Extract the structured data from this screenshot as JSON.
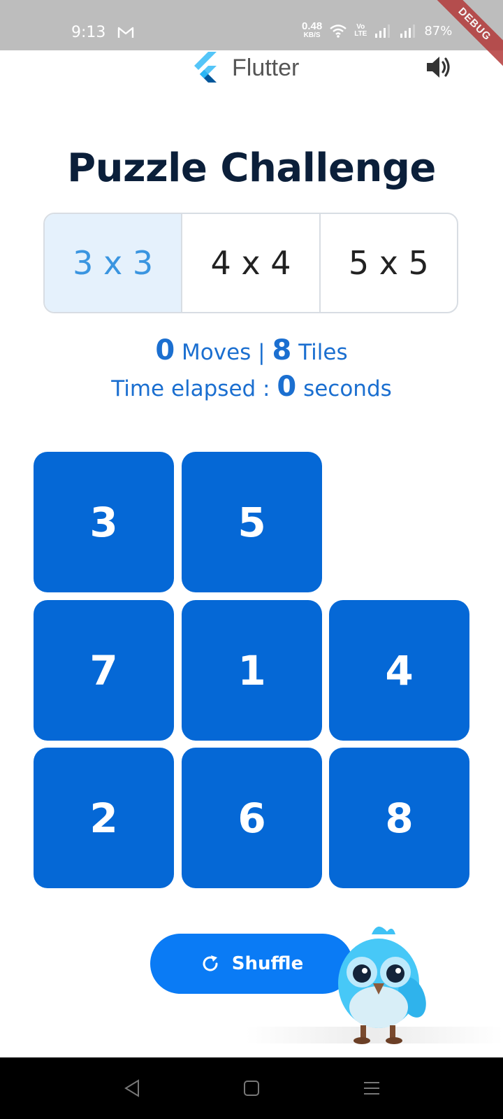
{
  "status_bar": {
    "time": "9:13",
    "mail_icon": "gmail-icon",
    "net_speed_value": "0.48",
    "net_speed_unit": "KB/S",
    "volte_top": "Vo",
    "volte_bottom": "LTE",
    "battery": "87%",
    "debug_label": "DEBUG"
  },
  "app_bar": {
    "app_name": "Flutter",
    "logo_icon": "flutter-logo",
    "sound_icon": "volume-icon"
  },
  "title": "Puzzle Challenge",
  "size_options": [
    {
      "label": "3 x 3",
      "selected": true
    },
    {
      "label": "4 x 4",
      "selected": false
    },
    {
      "label": "5 x 5",
      "selected": false
    }
  ],
  "stats": {
    "moves": "0",
    "moves_label": "Moves |",
    "tiles": "8",
    "tiles_label": "Tiles",
    "time_label": "Time elapsed :",
    "time_value": "0",
    "time_unit": "seconds"
  },
  "board": {
    "size": 3,
    "tiles": [
      "3",
      "5",
      "",
      "7",
      "1",
      "4",
      "2",
      "6",
      "8"
    ]
  },
  "shuffle": {
    "label": "Shuffle",
    "icon": "refresh-icon"
  },
  "colors": {
    "tile": "#0568d6",
    "accent": "#1b6fd0",
    "title": "#0b1f3a",
    "button": "#0a7bf5",
    "selected_bg": "#e5f1fc"
  }
}
